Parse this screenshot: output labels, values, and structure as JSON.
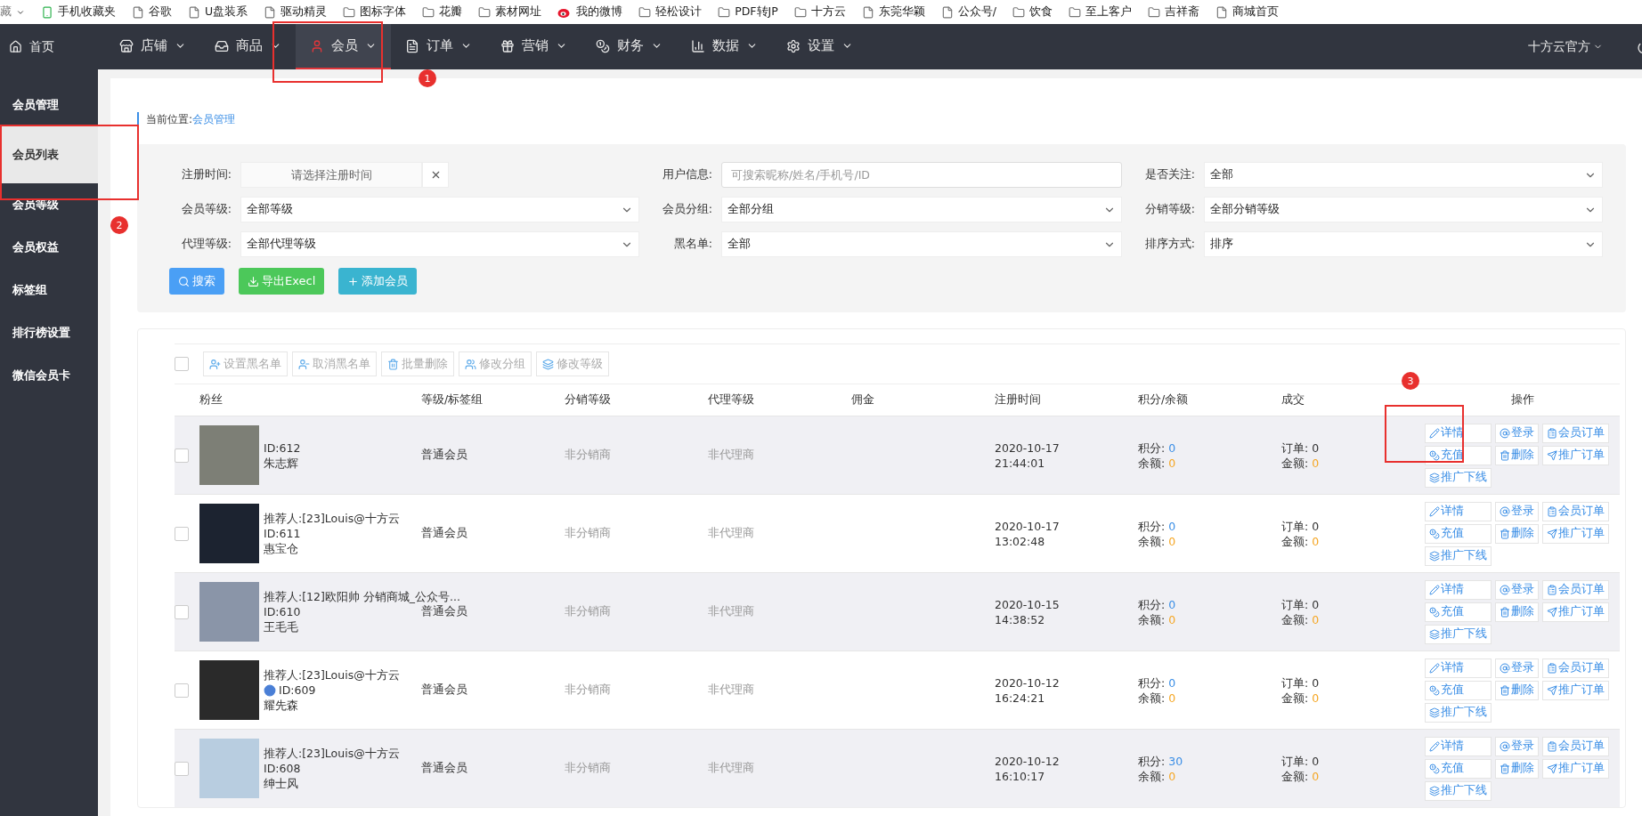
{
  "bookmarks": [
    {
      "kind": "cut",
      "label": "藏"
    },
    {
      "kind": "phone",
      "label": "手机收藏夹"
    },
    {
      "kind": "page",
      "label": "谷歌"
    },
    {
      "kind": "page",
      "label": "U盘装系"
    },
    {
      "kind": "page",
      "label": "驱动精灵"
    },
    {
      "kind": "folder",
      "label": "图标字体"
    },
    {
      "kind": "folder",
      "label": "花瓣"
    },
    {
      "kind": "folder",
      "label": "素材网址"
    },
    {
      "kind": "weibo",
      "label": "我的微博"
    },
    {
      "kind": "folder",
      "label": "轻松设计"
    },
    {
      "kind": "folder",
      "label": "PDF转JP"
    },
    {
      "kind": "folder",
      "label": "十方云"
    },
    {
      "kind": "page",
      "label": "东莞华颖"
    },
    {
      "kind": "page",
      "label": "公众号/"
    },
    {
      "kind": "folder",
      "label": "饮食"
    },
    {
      "kind": "folder",
      "label": "至上客户"
    },
    {
      "kind": "folder",
      "label": "吉祥斋"
    },
    {
      "kind": "page",
      "label": "商城首页"
    }
  ],
  "nav": {
    "home": "首页",
    "items": [
      {
        "kind": "store",
        "label": "店铺",
        "selected": false
      },
      {
        "kind": "goods",
        "label": "商品",
        "selected": false
      },
      {
        "kind": "member",
        "label": "会员",
        "selected": true
      },
      {
        "kind": "order",
        "label": "订单",
        "selected": false
      },
      {
        "kind": "marketing",
        "label": "营销",
        "selected": false
      },
      {
        "kind": "finance",
        "label": "财务",
        "selected": false
      },
      {
        "kind": "data",
        "label": "数据",
        "selected": false
      },
      {
        "kind": "settings",
        "label": "设置",
        "selected": false
      }
    ],
    "account": "十方云官方"
  },
  "sidebar": {
    "items": [
      {
        "label": "会员管理",
        "selected": false
      },
      {
        "label": "会员列表",
        "selected": true
      },
      {
        "label": "会员等级",
        "selected": false
      },
      {
        "label": "会员权益",
        "selected": false
      },
      {
        "label": "标签组",
        "selected": false
      },
      {
        "label": "排行榜设置",
        "selected": false
      },
      {
        "label": "微信会员卡",
        "selected": false
      }
    ]
  },
  "breadcrumb": {
    "label": "当前位置:",
    "link": "会员管理"
  },
  "filters": [
    {
      "kind": "date",
      "label": "注册时间:",
      "placeholder": "请选择注册时间"
    },
    {
      "kind": "text",
      "label": "用户信息:",
      "placeholder": "可搜索昵称/姓名/手机号/ID"
    },
    {
      "kind": "select",
      "label": "是否关注:",
      "value": "全部"
    },
    {
      "kind": "select",
      "label": "会员等级:",
      "value": "全部等级"
    },
    {
      "kind": "select",
      "label": "会员分组:",
      "value": "全部分组"
    },
    {
      "kind": "select",
      "label": "分销等级:",
      "value": "全部分销等级"
    },
    {
      "kind": "select",
      "label": "代理等级:",
      "value": "全部代理等级"
    },
    {
      "kind": "select",
      "label": "黑名单:",
      "value": "全部"
    },
    {
      "kind": "select",
      "label": "排序方式:",
      "value": "排序"
    }
  ],
  "filter_buttons": [
    {
      "kind": "search",
      "label": "搜索"
    },
    {
      "kind": "export",
      "label": "导出Execl"
    },
    {
      "kind": "add",
      "label": "添加会员"
    }
  ],
  "select_all": {
    "checked": false
  },
  "toolbar": [
    {
      "kind": "blacklist",
      "label": "设置黑名单",
      "disabled": true
    },
    {
      "kind": "unblacklist",
      "label": "取消黑名单",
      "disabled": true
    },
    {
      "kind": "delete",
      "label": "批量删除",
      "disabled": true
    },
    {
      "kind": "group",
      "label": "修改分组",
      "disabled": true
    },
    {
      "kind": "level",
      "label": "修改等级",
      "disabled": true
    }
  ],
  "table": {
    "columns": [
      "粉丝",
      "等级/标签组",
      "分销等级",
      "代理等级",
      "佣金",
      "注册时间",
      "积分/余额",
      "成交",
      "操作"
    ],
    "rows": [
      {
        "checked": false,
        "referrer": "",
        "badge": false,
        "id": "ID:612",
        "name": "朱志辉",
        "level": "普通会员",
        "distribution": "非分销商",
        "agent": "非代理商",
        "date": "2020-10-17",
        "time": "21:44:01",
        "points": {
          "label": "积分:",
          "value": "0"
        },
        "balance": {
          "label": "余额:",
          "value": "0"
        },
        "orders": {
          "label": "订单:",
          "value": "0"
        },
        "amount": {
          "label": "金额:",
          "value": "0"
        },
        "actions": [
          {
            "kind": "detail",
            "label": "详情"
          },
          {
            "kind": "login",
            "label": "登录"
          },
          {
            "kind": "orders",
            "label": "会员订单"
          },
          {
            "kind": "recharge",
            "label": "充值"
          },
          {
            "kind": "delete",
            "label": "删除"
          },
          {
            "kind": "promo",
            "label": "推广订单"
          },
          {
            "kind": "downline",
            "label": "推广下线"
          }
        ]
      },
      {
        "checked": false,
        "referrer": "推荐人:[23]Louis@十方云",
        "badge": false,
        "id": "ID:611",
        "name": "惠宝仓",
        "level": "普通会员",
        "distribution": "非分销商",
        "agent": "非代理商",
        "date": "2020-10-17",
        "time": "13:02:48",
        "points": {
          "label": "积分:",
          "value": "0"
        },
        "balance": {
          "label": "余额:",
          "value": "0"
        },
        "orders": {
          "label": "订单:",
          "value": "0"
        },
        "amount": {
          "label": "金额:",
          "value": "0"
        },
        "actions": [
          {
            "kind": "detail",
            "label": "详情"
          },
          {
            "kind": "login",
            "label": "登录"
          },
          {
            "kind": "orders",
            "label": "会员订单"
          },
          {
            "kind": "recharge",
            "label": "充值"
          },
          {
            "kind": "delete",
            "label": "删除"
          },
          {
            "kind": "promo",
            "label": "推广订单"
          },
          {
            "kind": "downline",
            "label": "推广下线"
          }
        ]
      },
      {
        "checked": false,
        "referrer": "推荐人:[12]欧阳帅 分销商城_公众号...",
        "badge": false,
        "id": "ID:610",
        "name": "王毛毛",
        "level": "普通会员",
        "distribution": "非分销商",
        "agent": "非代理商",
        "date": "2020-10-15",
        "time": "14:38:52",
        "points": {
          "label": "积分:",
          "value": "0"
        },
        "balance": {
          "label": "余额:",
          "value": "0"
        },
        "orders": {
          "label": "订单:",
          "value": "0"
        },
        "amount": {
          "label": "金额:",
          "value": "0"
        },
        "actions": [
          {
            "kind": "detail",
            "label": "详情"
          },
          {
            "kind": "login",
            "label": "登录"
          },
          {
            "kind": "orders",
            "label": "会员订单"
          },
          {
            "kind": "recharge",
            "label": "充值"
          },
          {
            "kind": "delete",
            "label": "删除"
          },
          {
            "kind": "promo",
            "label": "推广订单"
          },
          {
            "kind": "downline",
            "label": "推广下线"
          }
        ]
      },
      {
        "checked": false,
        "referrer": "推荐人:[23]Louis@十方云",
        "badge": true,
        "id": "ID:609",
        "name": "耀先森",
        "level": "普通会员",
        "distribution": "非分销商",
        "agent": "非代理商",
        "date": "2020-10-12",
        "time": "16:24:21",
        "points": {
          "label": "积分:",
          "value": "0"
        },
        "balance": {
          "label": "余额:",
          "value": "0"
        },
        "orders": {
          "label": "订单:",
          "value": "0"
        },
        "amount": {
          "label": "金额:",
          "value": "0"
        },
        "actions": [
          {
            "kind": "detail",
            "label": "详情"
          },
          {
            "kind": "login",
            "label": "登录"
          },
          {
            "kind": "orders",
            "label": "会员订单"
          },
          {
            "kind": "recharge",
            "label": "充值"
          },
          {
            "kind": "delete",
            "label": "删除"
          },
          {
            "kind": "promo",
            "label": "推广订单"
          },
          {
            "kind": "downline",
            "label": "推广下线"
          }
        ]
      },
      {
        "checked": false,
        "referrer": "推荐人:[23]Louis@十方云",
        "badge": false,
        "id": "ID:608",
        "name": "绅士风",
        "level": "普通会员",
        "distribution": "非分销商",
        "agent": "非代理商",
        "date": "2020-10-12",
        "time": "16:10:17",
        "points": {
          "label": "积分:",
          "value": "30"
        },
        "balance": {
          "label": "余额:",
          "value": "0"
        },
        "orders": {
          "label": "订单:",
          "value": "0"
        },
        "amount": {
          "label": "金额:",
          "value": "0"
        },
        "actions": [
          {
            "kind": "detail",
            "label": "详情"
          },
          {
            "kind": "login",
            "label": "登录"
          },
          {
            "kind": "orders",
            "label": "会员订单"
          },
          {
            "kind": "recharge",
            "label": "充值"
          },
          {
            "kind": "delete",
            "label": "删除"
          },
          {
            "kind": "promo",
            "label": "推广订单"
          },
          {
            "kind": "downline",
            "label": "推广下线"
          }
        ]
      }
    ]
  },
  "annotations": [
    {
      "label": "1"
    },
    {
      "label": "2"
    },
    {
      "label": "3"
    }
  ]
}
